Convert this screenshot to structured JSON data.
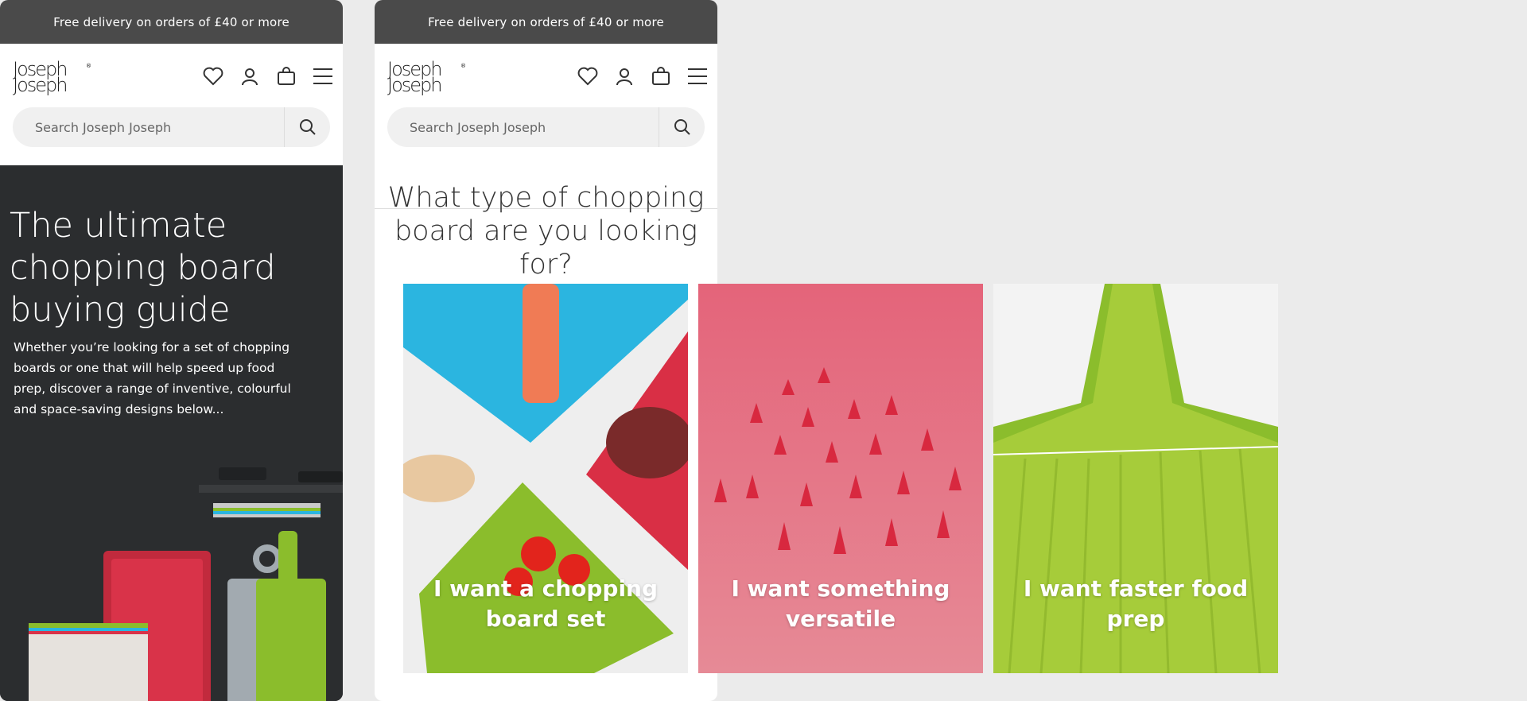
{
  "promo": {
    "text": "Free delivery on orders of £40 or more"
  },
  "logo": {
    "line1": "Joseph",
    "line2": "Joseph",
    "mark": "®"
  },
  "header": {
    "icons": [
      "heart-icon",
      "user-icon",
      "bag-icon",
      "menu-icon"
    ]
  },
  "search": {
    "placeholder": "Search Joseph Joseph"
  },
  "hero": {
    "title": "The ultimate chopping board buying guide",
    "body": "Whether you’re looking for a set of chopping boards or one that will help speed up food prep, discover a range of inventive, colourful and space-saving designs below..."
  },
  "question": {
    "title": "What type of chopping board are you looking for?"
  },
  "cards": [
    {
      "label": "I want a chopping board set"
    },
    {
      "label": "I want something versatile"
    },
    {
      "label": "I want faster food prep"
    }
  ],
  "colors": {
    "promo": "#4a4a4a",
    "hero": "#2a2c2e",
    "blue": "#2bb5e0",
    "red": "#d92f45",
    "green": "#8bbd2c",
    "pink": "#e07080"
  }
}
